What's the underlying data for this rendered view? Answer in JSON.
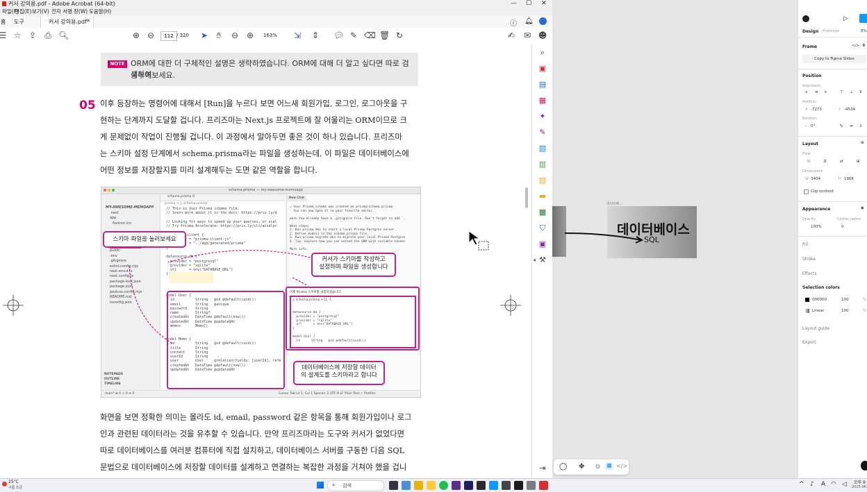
{
  "acrobat": {
    "title": "커서 강의용.pdf - Adobe Acrobat (64-bit)",
    "menu": [
      "파일(F)",
      "편집(E)",
      "보기(V)",
      "전자 서명",
      "창(W)",
      "도움말(H)"
    ],
    "tabs": {
      "home": "홈",
      "tools": "도구",
      "doc": "커서 강의용.pdf"
    },
    "page_current": "112",
    "page_total": "/ 320",
    "zoom": "163%"
  },
  "doc": {
    "note_badge": "NOTE",
    "note_line1": "ORM에 대한 더 구체적인 설명은 생략하였습니다. ORM에 대해 더 알고 싶다면 따로 검색하여",
    "note_line2": "공부해보세요.",
    "step_number": "05",
    "para1": [
      "이후 등장하는 명령어에 대해서 [Run]을 누르다 보면 어느새 회원가입, 로그인, 로그아웃을 구",
      "현하는 단계까지 도달할 겁니다. 프리즈마는 Next.js 프로젝트에 잘 어울리는 ORM이므로 크",
      "게 문제없이 작업이 진행될 겁니다. 이 과정에서 알아두면 좋은 것이 하나 있습니다. 프리즈마",
      "는 스키마 설정 단계에서 schema.prisma라는 파일을 생성하는데, 이 파일은 데이터베이스에",
      "어떤 정보를 저장할지를 미리 설계해두는 도면 같은 역할을 합니다."
    ],
    "para2": [
      "화면을 보면 정확한 의미는 몰라도 id, email, password 같은 항목을 통해 회원가입이나 로그",
      "인과 관련된 데이터라는 것을 유추할 수 있습니다. 만약 프리즈마라는 도구와 커서가 없었다면",
      "따로 데이터베이스를 여러분 컴퓨터에 직접 설치하고, 데이터베이스 서버를 구동한 다음 SQL",
      "문법으로 데이터베이스에 저장할 데이터를 설계하고 연결하는 복잡한 과정을 거쳐야 했을 겁니"
    ]
  },
  "screenshot": {
    "window_title": "schema.prisma — my-awesome-memoapp",
    "explorer_title": "MY-AWESOME-MEMOAPP",
    "files": [
      ".next",
      "app",
      "favicon.ico",
      "node_modules",
      "prisma",
      "schema.prisma",
      "public",
      ".env",
      ".gitignore",
      "eslint.config.mjs",
      "next-env.d.ts",
      "next.config.ts",
      "package-lock.json",
      "package.json",
      "postcss.config.mjs",
      "README.md",
      "tsconfig.json"
    ],
    "outline_items": [
      "NOTEPADS",
      "OUTLINE",
      "TIMELINE"
    ],
    "tab_label": "schema.prisma U",
    "breadcrumb": "prisma > ◬ schema.prisma",
    "code_top": "  // This is your Prisma schema file,\n  // learn more about it in the docs: https://pris.ly/d\n\n  // Looking for ways to speed up your queries, or scal\n  // Try Prisma Accelerate: https://pris.ly/cli/acceler\n\n  generator client {\n    provider = \"prisma-client-js\"\n    output   = \"../app/generated/prisma\"\n  }\n\n  datasource db {\n    provider = \"postgresql\"\n    provider = \"sqlite\"\n    url      = env(\"DATABASE_URL\")\n  }",
    "code_bottom": "  model User {\n    id          String   @id @default(cuid())\n    email       String   @unique\n    password    String\n    name        String?\n    createdAt   DateTime @default(now())\n    updatedAt   DateTime @updatedAt\n    memos       Memo[]\n  }\n\n  model Memo {\n    id          String   @id @default(cuid())\n    title       String\n    content     String\n    userId      String\n    user        User     @relation(fields: [userId], refe\n    createdAt   DateTime @default(now())\n    updatedAt   DateTime @updatedAt",
    "chat_tab": "New Chat",
    "chat_text": "✓ Your Prisma schema was created at prisma/schema.prisma\n  You can now open it in your favorite editor.\n\nwarn You already have a .gitignore file. Don't forget to add `.\n\nNext steps:\n1. Run prisma dev to start a local Prisma Postgres server.\n2. Define models in the schema.prisma file.\n3. Run prisma migrate dev to migrate your local Prisma Postgres\n4. Tip: Explore how you can extend the ORM with scalable connec\n\nMore info",
    "chat_sub_title": "이제 Prisma 스키마를 설정하겠습니다:",
    "chat_sub_file": "◬ schema.prisma +11 -1",
    "chat_code": "datasource db {\n  provider = \"postgresql\"\n  provider = \"sqlite\"\n  url      = env(\"DATABASE_URL\")\n}\n\nmodel User {\n  id      String   @id @default(cuid())",
    "callout1": "스키마 파일을 눌러보세요",
    "callout2_l1": "커서가 스키마를 작성하고",
    "callout2_l2": "설정하며 파일을 생성합니다",
    "callout3_l1": "데이터베이스에 저장할 데이터",
    "callout3_l2": "의 설계도를 스키마라고 합니다",
    "status_left": "main*  ⊗ 0 ⚠ 0  ⊘ 0",
    "status_right": "Cursor Tab   Ln 1, Col 1   Spaces: 2   UTF-8   LF   Plain Text   ✓ Prettier"
  },
  "figma": {
    "canvas_frame_label": "Frame",
    "db_node_title": "데이터베이스",
    "db_node_sub": "SQL",
    "db_node_caption": "데이터베...",
    "tabs": {
      "design": "Design",
      "prototype": "Prototype",
      "zoom": "8%"
    },
    "frame_label": "Frame",
    "copy_button": "Copy to Figma Slides",
    "position_title": "Position",
    "alignment_label": "Alignment",
    "position_label": "Position",
    "x": "-7273",
    "y": "-4534",
    "rotation_label": "Rotation",
    "rotation": "0°",
    "layout_title": "Layout",
    "flow_label": "Flow",
    "dimensions_label": "Dimensions",
    "w": "3404",
    "h": "1966",
    "clip_content": "Clip content",
    "appearance_title": "Appearance",
    "opacity_label": "Opacity",
    "corner_label": "Corner radius",
    "opacity": "100%",
    "corner": "0",
    "fill": "Fill",
    "stroke": "Stroke",
    "effects": "Effects",
    "selection_colors": "Selection colors",
    "color1_hex": "000000",
    "color1_pct": "100",
    "color2_name": "Linear",
    "color2_pct": "100",
    "layout_guide": "Layout guide",
    "export": "Export"
  },
  "taskbar": {
    "weather_temp": "25°C",
    "weather_desc": "구름 조금",
    "search": "검색",
    "time": "오후 9",
    "date": "2025-06"
  },
  "colors": {
    "accent": "#d9006c",
    "callout": "#c51f8a",
    "figma_blue": "#0d99ff"
  }
}
